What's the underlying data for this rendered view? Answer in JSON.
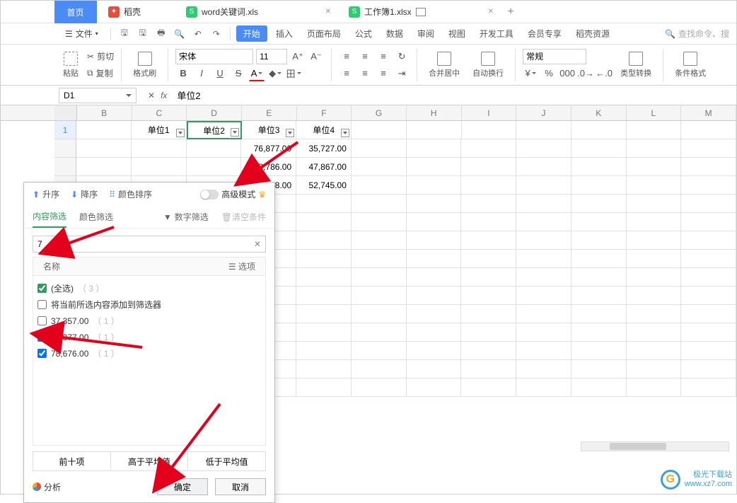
{
  "tabs": {
    "home": "首页",
    "docshell": "稻壳",
    "file1": "word关键词.xls",
    "file2": "工作簿1.xlsx"
  },
  "menubar": {
    "file": "文件",
    "items": [
      "开始",
      "插入",
      "页面布局",
      "公式",
      "数据",
      "审阅",
      "视图",
      "开发工具",
      "会员专享",
      "稻壳资源"
    ],
    "search_placeholder": "查找命令、搜"
  },
  "ribbon": {
    "clipboard": {
      "paste": "粘贴",
      "cut": "剪切",
      "copy": "复制",
      "fmtpaint": "格式刷"
    },
    "font_name": "宋体",
    "font_size": "11",
    "merge": "合并居中",
    "wrap": "自动换行",
    "numfmt": "常规",
    "typeconv": "类型转换",
    "condfmt": "条件格式"
  },
  "namebox": "D1",
  "formula": "单位2",
  "cols": [
    "B",
    "C",
    "D",
    "E",
    "F",
    "G",
    "H",
    "I",
    "J",
    "K",
    "L",
    "M"
  ],
  "row1": {
    "num": "1",
    "c": "单位1",
    "d": "单位2",
    "e": "单位3",
    "f": "单位4"
  },
  "data_rows": [
    {
      "e": "76,877.00",
      "f": "35,727.00"
    },
    {
      "e": "78,786.00",
      "f": "47,867.00"
    },
    {
      "e": "78,678.00",
      "f": "52,745.00"
    }
  ],
  "filter": {
    "asc": "升序",
    "desc": "降序",
    "colorSort": "颜色排序",
    "advMode": "高级模式",
    "tabs": {
      "content": "内容筛选",
      "color": "颜色筛选",
      "number": "数字筛选",
      "clear": "清空条件"
    },
    "search_value": "7",
    "listHead": {
      "name": "名称",
      "opts": "选项"
    },
    "selectAll": "(全选)",
    "selectAllCount": "（ 3 ）",
    "addCurrent": "将当前所选内容添加到筛选器",
    "items": [
      {
        "label": "37,357.00",
        "count": "（ 1 ）",
        "checked": false
      },
      {
        "label": "65,377.00",
        "count": "（ 1 ）",
        "checked": true
      },
      {
        "label": "78,676.00",
        "count": "（ 1 ）",
        "checked": true
      }
    ],
    "quick": {
      "top10": "前十项",
      "above": "高于平均值",
      "below": "低于平均值"
    },
    "analyze": "分析",
    "ok": "确定",
    "cancel": "取消"
  },
  "watermark": {
    "l1": "极光下载站",
    "l2": "www.xz7.com"
  }
}
